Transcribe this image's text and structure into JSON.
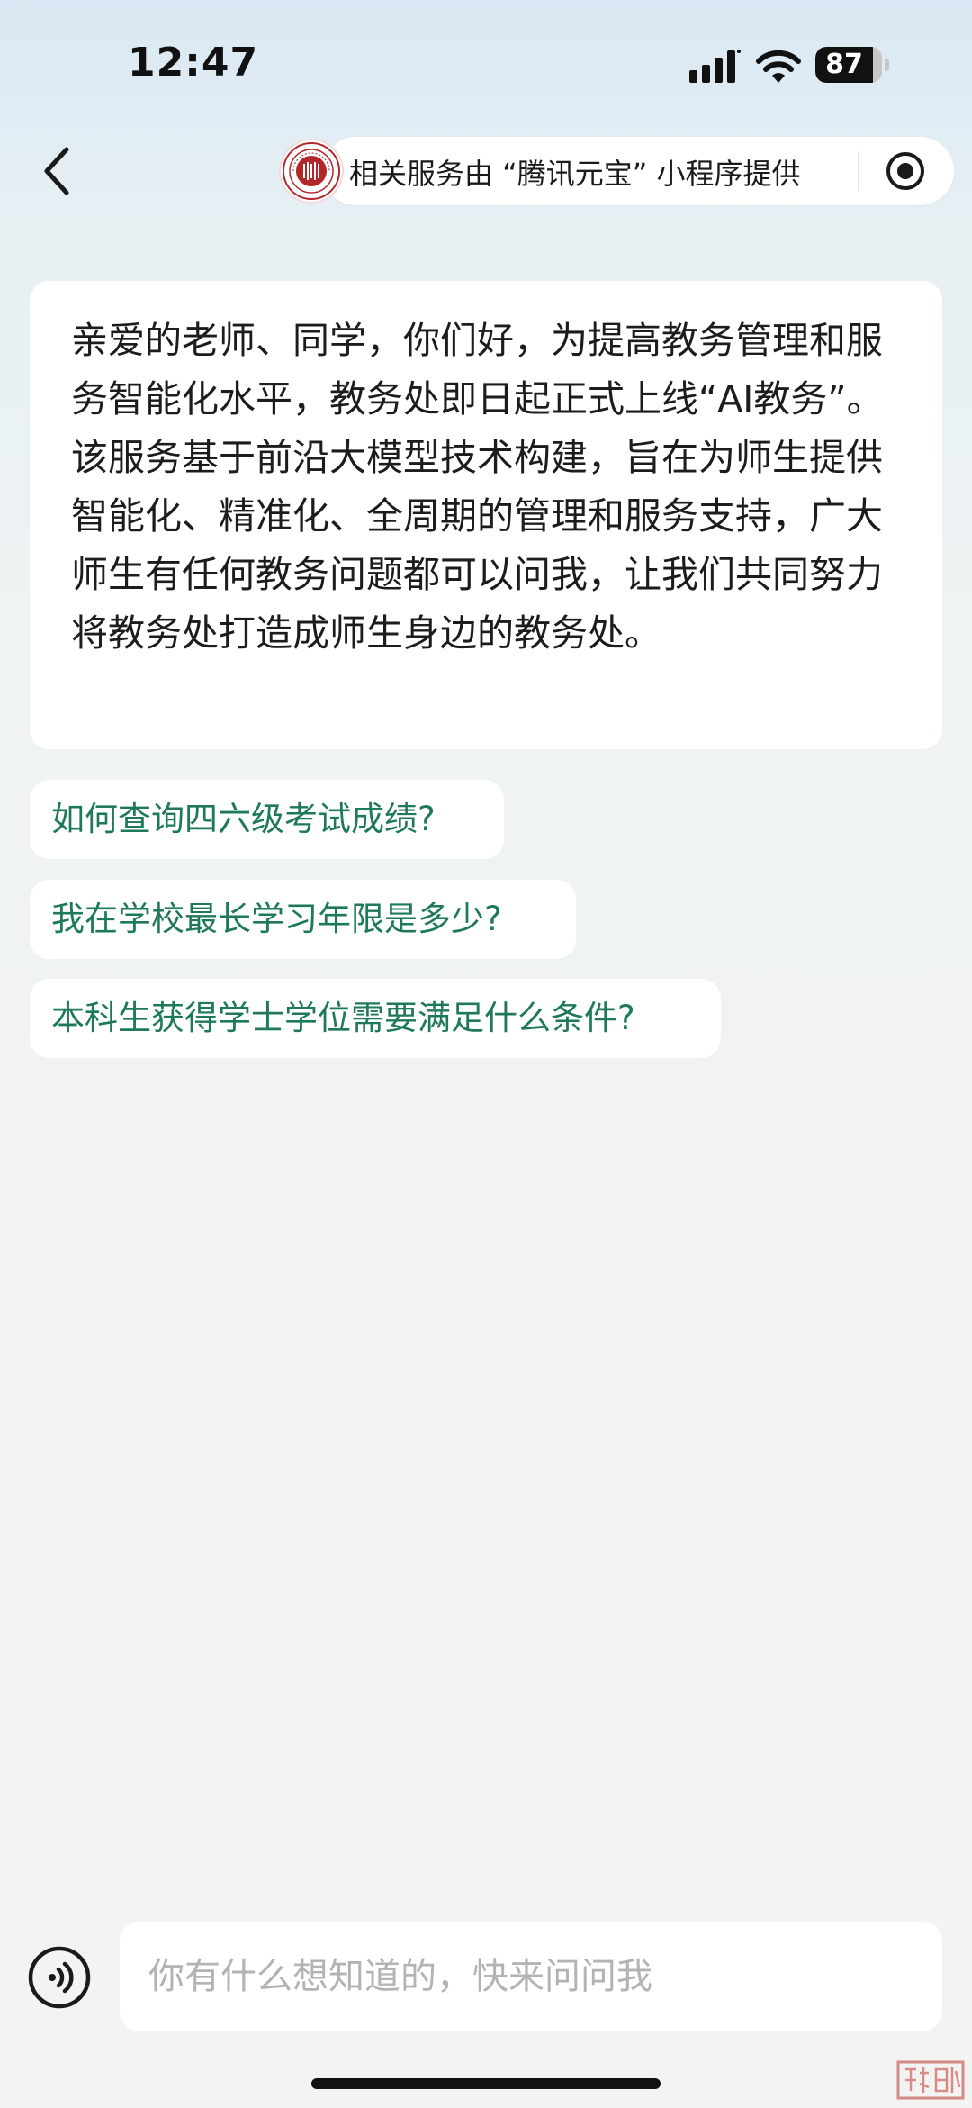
{
  "status_bar": {
    "time": "12:47",
    "battery_level": "87",
    "battery_fraction": 0.87,
    "signal_icon": "cellular-signal-icon",
    "wifi_icon": "wifi-icon"
  },
  "nav": {
    "back_icon": "chevron-left-icon",
    "service_notice": "相关服务由 “腾讯元宝” 小程序提供",
    "logo_icon": "university-seal-logo",
    "close_icon": "record-close-icon"
  },
  "welcome_message": {
    "text": "亲爱的老师、同学，你们好，为提高教务管理和服务智能化水平，教务处即日起正式上线“AI教务”。该服务基于前沿大模型技术构建，旨在为师生提供智能化、精准化、全周期的管理和服务支持，广大师生有任何教务问题都可以问我，让我们共同努力将教务处打造成师生身边的教务处。"
  },
  "suggestions": [
    {
      "label": "如何查询四六级考试成绩?"
    },
    {
      "label": "我在学校最长学习年限是多少?"
    },
    {
      "label": "本科生获得学士学位需要满足什么条件?"
    }
  ],
  "input": {
    "placeholder": "你有什么想知道的，快来问问我",
    "value": "",
    "voice_icon": "voice-input-icon"
  },
  "colors": {
    "accent_green": "#1e7a56",
    "card_bg": "#ffffff",
    "placeholder": "#b3b3b3"
  }
}
